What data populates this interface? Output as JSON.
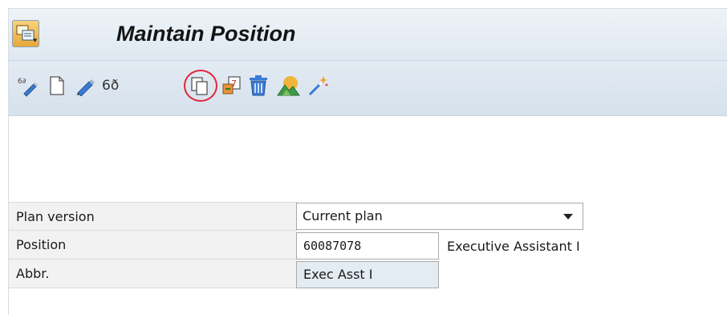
{
  "header": {
    "title": "Maintain Position",
    "menu_button_icon": "menu-icon"
  },
  "toolbar": {
    "items": [
      {
        "name": "edit-icon"
      },
      {
        "name": "new-icon"
      },
      {
        "name": "change-icon"
      },
      {
        "name": "display-icon"
      },
      {
        "name": "copy-icon",
        "highlighted": true
      },
      {
        "name": "delimit-icon"
      },
      {
        "name": "delete-icon"
      },
      {
        "name": "overview-icon"
      },
      {
        "name": "wizard-icon"
      }
    ],
    "highlight_color": "#e0263b"
  },
  "form": {
    "plan_version": {
      "label": "Plan version",
      "value": "Current plan"
    },
    "position": {
      "label": "Position",
      "value": "60087078",
      "description": "Executive Assistant I"
    },
    "abbr": {
      "label": "Abbr.",
      "value": "Exec Asst I"
    }
  }
}
